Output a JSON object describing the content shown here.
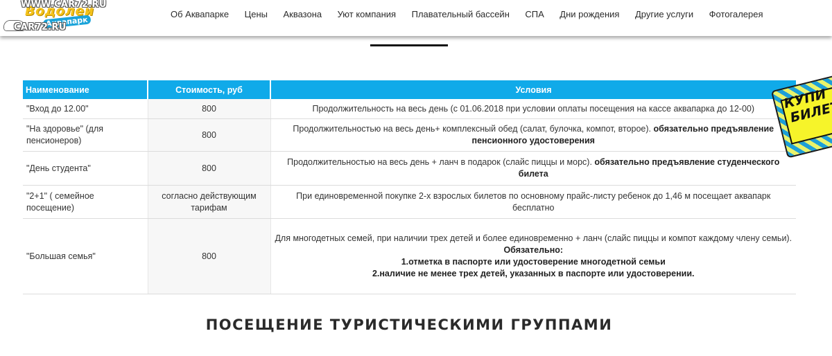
{
  "header": {
    "logo": {
      "brand": "Водолей",
      "subtitle": "Аквапарк",
      "watermark_top": "WWW.CAR72.RU",
      "watermark_bottom": "CAR72.RU"
    },
    "nav": [
      {
        "label": "Об Аквапарке"
      },
      {
        "label": "Цены"
      },
      {
        "label": "Аквазона"
      },
      {
        "label": "Уют компания"
      },
      {
        "label": "Плавательный бассейн"
      },
      {
        "label": "СПА"
      },
      {
        "label": "Дни рождения"
      },
      {
        "label": "Другие услуги"
      },
      {
        "label": "Фотогалерея"
      }
    ]
  },
  "table": {
    "headers": {
      "name": "Наименование",
      "price": "Стоимость, руб",
      "conditions": "Условия"
    },
    "rows": [
      {
        "name": "\"Вход до 12.00\"",
        "price": "800",
        "conditions": "Продолжительность на весь день (с 01.06.2018 при условии оплаты посещения на кассе аквапарка до 12-00)",
        "conditions_bold": ""
      },
      {
        "name": "\"На здоровье\" (для пенсионеров)",
        "price": "800",
        "conditions": "Продолжительностью на весь день+ комплексный обед (салат, булочка, компот, второе).",
        "conditions_bold": "обязательно предъявление пенсионного удостоверения"
      },
      {
        "name": "\"День студента\"",
        "price": "800",
        "conditions": "Продолжительностью на весь день + ланч в подарок (слайс пиццы и морс).",
        "conditions_bold": "обязательно предъявление студенческого билета"
      },
      {
        "name": "\"2+1\" ( семейное посещение)",
        "price": "согласно действующим тарифам",
        "conditions": "При единовременной покупке 2-х взрослых билетов по основному прайс-листу ребенок до 1,46 м посещает аквапарк бесплатно",
        "conditions_bold": ""
      },
      {
        "name": "\"Большая семья\"",
        "price": "800",
        "conditions": "Для многодетных семей, при наличии трех детей и более единовременно + ланч (слайс пиццы и компот каждому члену семьи).",
        "conditions_bold_lines": [
          "Обязательно:",
          "1.отметка в паспорте или удостоверение многодетной семьи",
          "2.наличие не менее трех детей, указанных в паспорте или удостоверении."
        ]
      }
    ]
  },
  "ticket_badge": {
    "line1": "КУПИ",
    "line2": "БИЛЕТ"
  },
  "section_title": "ПОСЕЩЕНИЕ ТУРИСТИЧЕСКИМИ ГРУППАМИ"
}
